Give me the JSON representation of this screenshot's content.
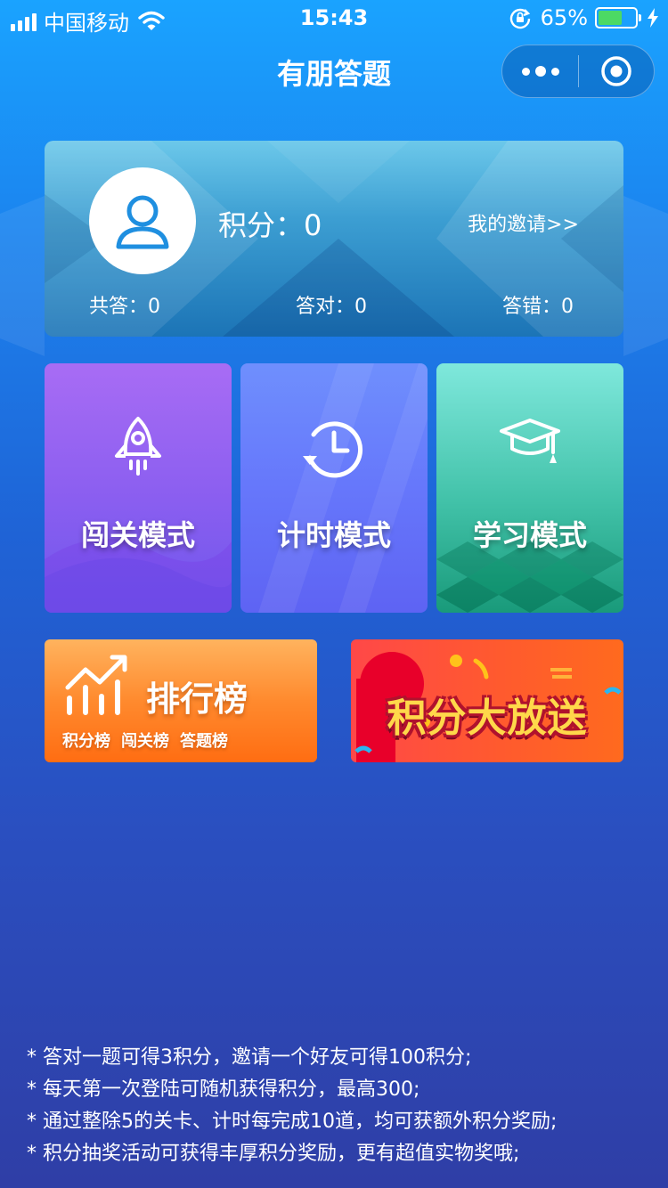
{
  "status_bar": {
    "carrier": "中国移动",
    "time": "15:43",
    "battery_percent": "65%",
    "battery_level": 0.65
  },
  "nav": {
    "title": "有朋答题"
  },
  "profile": {
    "score_label": "积分：",
    "score_value": "0",
    "invite_link": "我的邀请>>",
    "stats": [
      {
        "label": "共答：",
        "value": "0"
      },
      {
        "label": "答对：",
        "value": "0"
      },
      {
        "label": "答错：",
        "value": "0"
      }
    ]
  },
  "modes": [
    {
      "label": "闯关模式",
      "icon": "rocket-icon"
    },
    {
      "label": "计时模式",
      "icon": "history-clock-icon"
    },
    {
      "label": "学习模式",
      "icon": "graduation-cap-icon"
    }
  ],
  "rank_banner": {
    "title": "排行榜",
    "subs": [
      "积分榜",
      "闯关榜",
      "答题榜"
    ],
    "icon": "trend-chart-icon"
  },
  "points_banner": {
    "title": "积分大放送"
  },
  "rules": [
    "* 答对一题可得3积分，邀请一个好友可得100积分;",
    "* 每天第一次登陆可随机获得积分，最高300;",
    "* 通过整除5的关卡、计时每完成10道，均可获额外积分奖励;",
    "* 积分抽奖活动可获得丰厚积分奖励，更有超值实物奖哦;"
  ],
  "colors": {
    "battery_fill": "#4cd964",
    "rank_orange": "#ff8a2e",
    "points_red": "#ff4848",
    "points_text": "#ffd84a"
  }
}
